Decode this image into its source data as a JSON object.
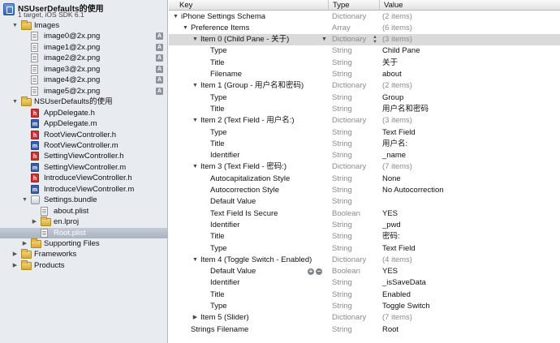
{
  "project": {
    "name": "NSUserDefaults的使用",
    "subtitle": "1 target, iOS SDK 6.1"
  },
  "navigator": [
    {
      "label": "Images",
      "kind": "folder",
      "depth": 1,
      "open": true
    },
    {
      "label": "image0@2x.png",
      "kind": "image",
      "depth": 2,
      "badge": "A"
    },
    {
      "label": "image1@2x.png",
      "kind": "image",
      "depth": 2,
      "badge": "A"
    },
    {
      "label": "image2@2x.png",
      "kind": "image",
      "depth": 2,
      "badge": "A"
    },
    {
      "label": "image3@2x.png",
      "kind": "image",
      "depth": 2,
      "badge": "A"
    },
    {
      "label": "image4@2x.png",
      "kind": "image",
      "depth": 2,
      "badge": "A"
    },
    {
      "label": "image5@2x.png",
      "kind": "image",
      "depth": 2,
      "badge": "A"
    },
    {
      "label": "NSUserDefaults的使用",
      "kind": "folder",
      "depth": 1,
      "open": true
    },
    {
      "label": "AppDelegate.h",
      "kind": "h",
      "depth": 2
    },
    {
      "label": "AppDelegate.m",
      "kind": "m",
      "depth": 2
    },
    {
      "label": "RootViewController.h",
      "kind": "h",
      "depth": 2
    },
    {
      "label": "RootViewController.m",
      "kind": "m",
      "depth": 2
    },
    {
      "label": "SettingViewController.h",
      "kind": "h",
      "depth": 2
    },
    {
      "label": "SettingViewController.m",
      "kind": "m",
      "depth": 2
    },
    {
      "label": "IntroduceViewController.h",
      "kind": "h",
      "depth": 2
    },
    {
      "label": "IntroduceViewController.m",
      "kind": "m",
      "depth": 2
    },
    {
      "label": "Settings.bundle",
      "kind": "bundle",
      "depth": 2,
      "open": true
    },
    {
      "label": "about.plist",
      "kind": "plist",
      "depth": 3
    },
    {
      "label": "en.lproj",
      "kind": "folder",
      "depth": 3,
      "open": false
    },
    {
      "label": "Root.plist",
      "kind": "plist",
      "depth": 3,
      "selected": true
    },
    {
      "label": "Supporting Files",
      "kind": "folder",
      "depth": 2,
      "open": false
    },
    {
      "label": "Frameworks",
      "kind": "folder",
      "depth": 1,
      "open": false
    },
    {
      "label": "Products",
      "kind": "folder",
      "depth": 1,
      "open": false
    }
  ],
  "editor": {
    "columns": {
      "key": "Key",
      "type": "Type",
      "value": "Value"
    },
    "rows": [
      {
        "key": "iPhone Settings Schema",
        "type": "Dictionary",
        "value": "(2 items)",
        "depth": 0,
        "tri": "open",
        "muted": true
      },
      {
        "key": "Preference Items",
        "type": "Array",
        "value": "(6 items)",
        "depth": 1,
        "tri": "open",
        "muted": true
      },
      {
        "key": "Item 0 (Child Pane - 关于)",
        "type": "Dictionary",
        "value": "(3 items)",
        "depth": 2,
        "tri": "open",
        "muted": true,
        "selected": true,
        "chevron": true,
        "stepper": true
      },
      {
        "key": "Type",
        "type": "String",
        "value": "Child Pane",
        "depth": 3
      },
      {
        "key": "Title",
        "type": "String",
        "value": "关于",
        "depth": 3
      },
      {
        "key": "Filename",
        "type": "String",
        "value": "about",
        "depth": 3
      },
      {
        "key": "Item 1 (Group - 用户名和密码)",
        "type": "Dictionary",
        "value": "(2 items)",
        "depth": 2,
        "tri": "open",
        "muted": true
      },
      {
        "key": "Type",
        "type": "String",
        "value": "Group",
        "depth": 3
      },
      {
        "key": "Title",
        "type": "String",
        "value": "用户名和密码",
        "depth": 3
      },
      {
        "key": "Item 2 (Text Field - 用户名:)",
        "type": "Dictionary",
        "value": "(3 items)",
        "depth": 2,
        "tri": "open",
        "muted": true
      },
      {
        "key": "Type",
        "type": "String",
        "value": "Text Field",
        "depth": 3
      },
      {
        "key": "Title",
        "type": "String",
        "value": "用户名:",
        "depth": 3
      },
      {
        "key": "Identifier",
        "type": "String",
        "value": "_name",
        "depth": 3
      },
      {
        "key": "Item 3 (Text Field - 密码:)",
        "type": "Dictionary",
        "value": "(7 items)",
        "depth": 2,
        "tri": "open",
        "muted": true
      },
      {
        "key": "Autocapitalization Style",
        "type": "String",
        "value": "None",
        "depth": 3
      },
      {
        "key": "Autocorrection Style",
        "type": "String",
        "value": "No Autocorrection",
        "depth": 3
      },
      {
        "key": "Default Value",
        "type": "String",
        "value": "",
        "depth": 3
      },
      {
        "key": "Text Field Is Secure",
        "type": "Boolean",
        "value": "YES",
        "depth": 3
      },
      {
        "key": "Identifier",
        "type": "String",
        "value": "_pwd",
        "depth": 3
      },
      {
        "key": "Title",
        "type": "String",
        "value": "密码:",
        "depth": 3
      },
      {
        "key": "Type",
        "type": "String",
        "value": "Text Field",
        "depth": 3
      },
      {
        "key": "Item 4 (Toggle Switch - Enabled)",
        "type": "Dictionary",
        "value": "(4 items)",
        "depth": 2,
        "tri": "open",
        "muted": true
      },
      {
        "key": "Default Value",
        "type": "Boolean",
        "value": "YES",
        "depth": 3,
        "addrm": true
      },
      {
        "key": "Identifier",
        "type": "String",
        "value": "_isSaveData",
        "depth": 3
      },
      {
        "key": "Title",
        "type": "String",
        "value": "Enabled",
        "depth": 3
      },
      {
        "key": "Type",
        "type": "String",
        "value": "Toggle Switch",
        "depth": 3
      },
      {
        "key": "Item 5 (Slider)",
        "type": "Dictionary",
        "value": "(7 items)",
        "depth": 2,
        "tri": "closed",
        "muted": true
      },
      {
        "key": "Strings Filename",
        "type": "String",
        "value": "Root",
        "depth": 1
      }
    ]
  }
}
